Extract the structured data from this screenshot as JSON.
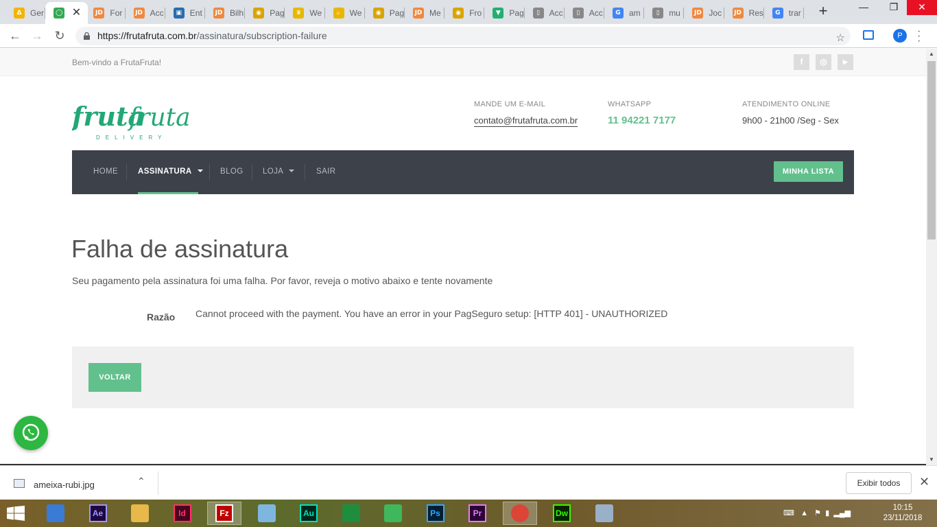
{
  "browser": {
    "tabs": [
      {
        "label": "Ger",
        "fav": "Δ",
        "color": "#f4b400"
      },
      {
        "label": "",
        "fav": "◯",
        "color": "#34a853",
        "active": true
      },
      {
        "label": "For",
        "fav": "JD",
        "color": "#f0883e"
      },
      {
        "label": "Acc",
        "fav": "JD",
        "color": "#f0883e"
      },
      {
        "label": "Ent",
        "fav": "▣",
        "color": "#2b6cb0"
      },
      {
        "label": "Bilh",
        "fav": "JD",
        "color": "#f0883e"
      },
      {
        "label": "Pag",
        "fav": "◉",
        "color": "#d9a400"
      },
      {
        "label": "We",
        "fav": "♛",
        "color": "#e6b800"
      },
      {
        "label": "We",
        "fav": "✋",
        "color": "#e6b800"
      },
      {
        "label": "Pag",
        "fav": "◉",
        "color": "#d9a400"
      },
      {
        "label": "Me",
        "fav": "JD",
        "color": "#f0883e"
      },
      {
        "label": "Fro",
        "fav": "◉",
        "color": "#d9a400"
      },
      {
        "label": "Pag",
        "fav": "▼",
        "color": "#20b070"
      },
      {
        "label": "Acc",
        "fav": "▯",
        "color": "#888888"
      },
      {
        "label": "Acc",
        "fav": "▯",
        "color": "#888888"
      },
      {
        "label": "am",
        "fav": "G",
        "color": "#4285f4"
      },
      {
        "label": "mu",
        "fav": "▯",
        "color": "#888888"
      },
      {
        "label": "Joc",
        "fav": "JD",
        "color": "#f0883e"
      },
      {
        "label": "Res",
        "fav": "JD",
        "color": "#f0883e"
      },
      {
        "label": "trar",
        "fav": "G",
        "color": "#4285f4"
      }
    ],
    "new_tab": "+",
    "url_host": "https://frutafruta.com.br",
    "url_path": "/assinatura/subscription-failure",
    "profile_initial": "P"
  },
  "site": {
    "welcome": "Bem-vindo a FrutaFruta!",
    "social": [
      "f",
      "◎",
      "▶"
    ],
    "logo_word1": "fruta",
    "logo_word2": "fruta",
    "logo_tagline": "DELIVERY",
    "contacts": [
      {
        "label": "MANDE UM E-MAIL",
        "value": "contato@frutafruta.com.br",
        "kind": "mail"
      },
      {
        "label": "WHATSAPP",
        "value": "11 94221 7177",
        "kind": "phone"
      },
      {
        "label": "ATENDIMENTO ONLINE",
        "value": "9h00 - 21h00 /Seg - Sex",
        "kind": "text"
      }
    ],
    "nav": {
      "home": "HOME",
      "assinatura": "ASSINATURA",
      "blog": "BLOG",
      "loja": "LOJA",
      "sair": "SAIR",
      "minha_lista": "MINHA LISTA"
    },
    "page_title": "Falha de assinatura",
    "subtitle": "Seu pagamento pela assinatura foi uma falha. Por favor, reveja o motivo abaixo e tente novamente",
    "reason_label": "Razão",
    "reason_value": "Cannot proceed with the payment. You have an error in your PagSeguro setup: [HTTP 401] - UNAUTHORIZED",
    "back_button": "VOLTAR",
    "brand_color": "#62c08d"
  },
  "downloads": {
    "file": "ameixa-rubi.jpg",
    "show_all": "Exibir todos"
  },
  "taskbar": {
    "apps": [
      {
        "name": "app-2r",
        "label": "",
        "fg": "#ffffff",
        "bg": "#3a7bd5"
      },
      {
        "name": "after-effects",
        "label": "Ae",
        "fg": "#9999ff",
        "bg": "#1f0740"
      },
      {
        "name": "file-explorer",
        "label": "",
        "fg": "#f5d76e",
        "bg": "#e8b84a"
      },
      {
        "name": "indesign",
        "label": "Id",
        "fg": "#ff3366",
        "bg": "#49021f"
      },
      {
        "name": "filezilla",
        "label": "Fz",
        "fg": "#ffffff",
        "bg": "#bf0000",
        "on": true
      },
      {
        "name": "notes",
        "label": "",
        "fg": "#ffffff",
        "bg": "#7fb6e0"
      },
      {
        "name": "audition",
        "label": "Au",
        "fg": "#00e4bb",
        "bg": "#00261c"
      },
      {
        "name": "calculator",
        "label": "",
        "fg": "#ffffff",
        "bg": "#1e8e3e"
      },
      {
        "name": "app-green",
        "label": "",
        "fg": "#ffffff",
        "bg": "#3fb75c"
      },
      {
        "name": "photoshop",
        "label": "Ps",
        "fg": "#31a8ff",
        "bg": "#001e36"
      },
      {
        "name": "premiere",
        "label": "Pr",
        "fg": "#ea77ff",
        "bg": "#2a0634"
      },
      {
        "name": "chrome",
        "label": "",
        "fg": "#ffffff",
        "bg": "#db4437",
        "on": true
      },
      {
        "name": "dreamweaver",
        "label": "Dw",
        "fg": "#35fa00",
        "bg": "#072401"
      },
      {
        "name": "monitor",
        "label": "",
        "fg": "#ffffff",
        "bg": "#9ab0c8"
      }
    ],
    "time": "10:15",
    "date": "23/11/2018"
  }
}
